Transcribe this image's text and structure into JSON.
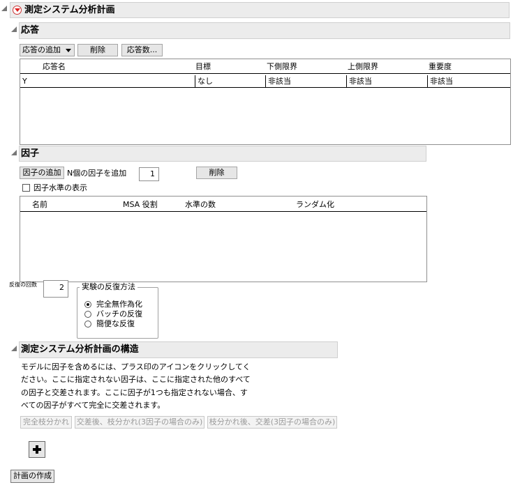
{
  "title": "測定システム分析計画",
  "responses": {
    "header": "応答",
    "add_response_label": "応答の追加",
    "delete_label": "削除",
    "count_label": "応答数...",
    "columns": [
      "応答名",
      "目標",
      "下側限界",
      "上側限界",
      "重要度"
    ],
    "rows": [
      {
        "name": "Y",
        "goal": "なし",
        "lower": "非該当",
        "upper": "非該当",
        "importance": "非該当"
      }
    ]
  },
  "factors": {
    "header": "因子",
    "add_factor_label": "因子の追加",
    "add_n_label": "N個の因子を追加",
    "n_value": "1",
    "delete_label": "削除",
    "show_levels_label": "因子水準の表示",
    "show_levels_checked": false,
    "columns": [
      "名前",
      "MSA 役割",
      "水準の数",
      "ランダム化"
    ]
  },
  "replicates": {
    "label": "反復の回数",
    "value": "2"
  },
  "replication_method": {
    "legend": "実験の反復方法",
    "options": [
      "完全無作為化",
      "バッチの反復",
      "簡便な反復"
    ],
    "selected": 0
  },
  "structure": {
    "header": "測定システム分析計画の構造",
    "description": [
      "モデルに因子を含めるには、プラス印のアイコンをクリックしてく",
      "ださい。ここに指定されない因子は、ここに指定された他のすべて",
      "の因子と交差されます。ここに因子が1つも指定されない場合、す",
      "べての因子がすべて完全に交差されます。"
    ],
    "buttons": [
      "完全枝分かれ",
      "交差後、枝分かれ(3因子の場合のみ)",
      "枝分かれ後、交差(3因子の場合のみ)"
    ]
  },
  "make_design_label": "計画の作成",
  "colors": {
    "header_bg": "#ececec",
    "red_triangle": "#e02020",
    "disabled_text": "#9a9a9a"
  }
}
